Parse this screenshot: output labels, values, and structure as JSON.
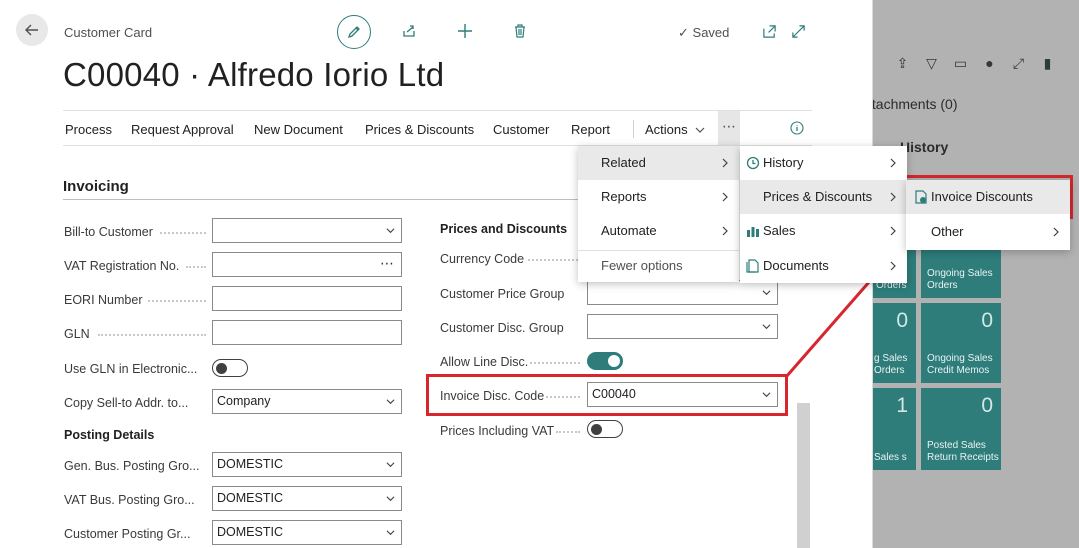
{
  "background": {
    "left_text": "s",
    "attachments": "ttachments (0)",
    "history": "History",
    "tiles": [
      {
        "value": "",
        "label": "Orders"
      },
      {
        "value": "",
        "label": "Ongoing Sales Orders"
      },
      {
        "value": "0",
        "label": "g Sales Orders"
      },
      {
        "value": "0",
        "label": "Ongoing Sales Credit Memos"
      },
      {
        "value": "1",
        "label": "Sales s"
      },
      {
        "value": "0",
        "label": "Posted Sales Return Receipts"
      }
    ]
  },
  "header": {
    "card_type": "Customer Card",
    "saved": "Saved",
    "title": "C00040 · Alfredo Iorio Ltd"
  },
  "actions": [
    "Process",
    "Request Approval",
    "New Document",
    "Prices & Discounts",
    "Customer",
    "Report"
  ],
  "actions_menu": "Actions",
  "section": {
    "title": "Invoicing",
    "left_fields": [
      {
        "label": "Bill-to Customer",
        "value": "",
        "type": "select"
      },
      {
        "label": "VAT Registration No.",
        "value": "",
        "type": "lookup"
      },
      {
        "label": "EORI Number",
        "value": "",
        "type": "text"
      },
      {
        "label": "GLN",
        "value": "",
        "type": "text"
      },
      {
        "label": "Use GLN in Electronic...",
        "value": false,
        "type": "toggle"
      },
      {
        "label": "Copy Sell-to Addr. to...",
        "value": "Company",
        "type": "select"
      }
    ],
    "posting_details": "Posting Details",
    "posting_fields": [
      {
        "label": "Gen. Bus. Posting Gro...",
        "value": "DOMESTIC"
      },
      {
        "label": "VAT Bus. Posting Gro...",
        "value": "DOMESTIC"
      },
      {
        "label": "Customer Posting Gr...",
        "value": "DOMESTIC"
      }
    ],
    "prices_discounts": "Prices and Discounts",
    "right_fields": [
      {
        "label": "Currency Code",
        "value": ""
      },
      {
        "label": "Customer Price Group",
        "value": ""
      },
      {
        "label": "Customer Disc. Group",
        "value": ""
      },
      {
        "label": "Allow Line Disc.",
        "value": true
      },
      {
        "label": "Invoice Disc. Code",
        "value": "C00040"
      },
      {
        "label": "Prices Including VAT",
        "value": false
      }
    ]
  },
  "menu1": [
    {
      "label": "Related",
      "submenu": true
    },
    {
      "label": "Reports",
      "submenu": true
    },
    {
      "label": "Automate",
      "submenu": true
    },
    {
      "label": "Fewer options",
      "submenu": false
    }
  ],
  "menu2": [
    {
      "label": "History",
      "icon": "history-icon"
    },
    {
      "label": "Prices & Discounts",
      "icon": ""
    },
    {
      "label": "Sales",
      "icon": "sales-icon"
    },
    {
      "label": "Documents",
      "icon": "documents-icon"
    }
  ],
  "menu3": [
    {
      "label": "Invoice Discounts",
      "icon": "invoice-discount-icon"
    },
    {
      "label": "Other",
      "icon": ""
    }
  ],
  "colors": {
    "accent": "#2e7d7b",
    "highlight": "#d7262e",
    "overlay": "#b2b2b2"
  }
}
